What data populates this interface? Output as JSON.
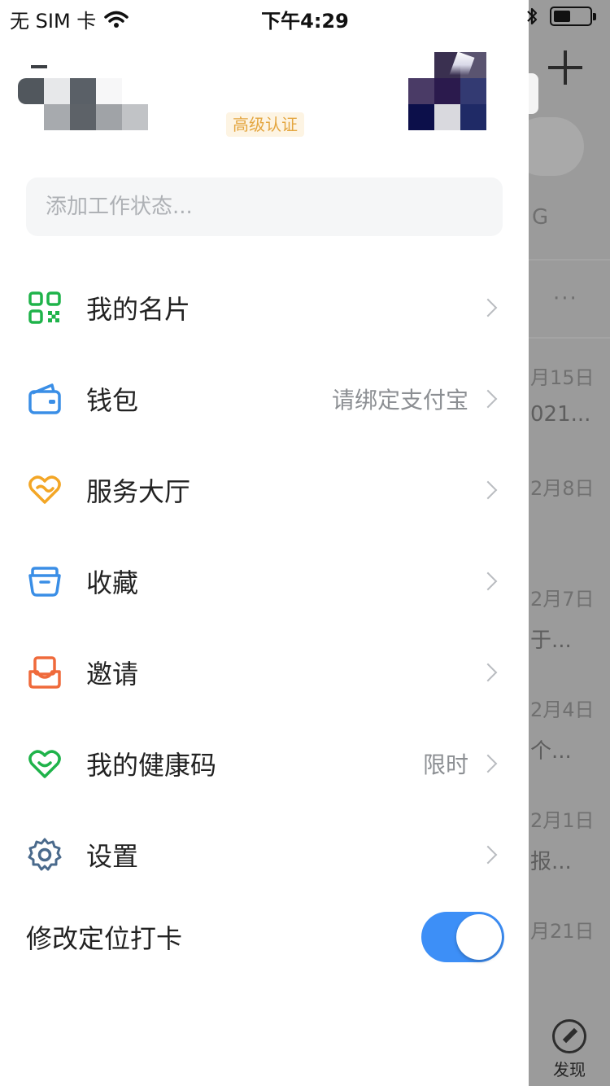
{
  "status_bar": {
    "carrier": "无 SIM 卡",
    "time": "下午4:29",
    "battery_level": 0.45,
    "icons": [
      "wifi-icon",
      "bluetooth-icon",
      "battery-icon"
    ]
  },
  "profile": {
    "badge": "高级认证"
  },
  "work_status": {
    "placeholder": "添加工作状态..."
  },
  "menu": {
    "items": [
      {
        "label": "我的名片",
        "extra": "",
        "icon": "qr-code-icon",
        "color": "#1fb34a"
      },
      {
        "label": "钱包",
        "extra": "请绑定支付宝",
        "icon": "wallet-icon",
        "color": "#3a8ee6"
      },
      {
        "label": "服务大厅",
        "extra": "",
        "icon": "heart-link-icon",
        "color": "#f3a626"
      },
      {
        "label": "收藏",
        "extra": "",
        "icon": "folder-icon",
        "color": "#3a8ee6"
      },
      {
        "label": "邀请",
        "extra": "",
        "icon": "invite-icon",
        "color": "#ef6a3b"
      },
      {
        "label": "我的健康码",
        "extra": "限时",
        "icon": "health-heart-icon",
        "color": "#1fb34a"
      },
      {
        "label": "设置",
        "extra": "",
        "icon": "gear-icon",
        "color": "#4a6a8c"
      }
    ]
  },
  "location_checkin": {
    "label": "修改定位打卡",
    "enabled": true,
    "accent": "#3d8ff7"
  },
  "background_app": {
    "letter": "G",
    "rows": [
      {
        "date": "月15日",
        "text": "021..."
      },
      {
        "date": "2月8日",
        "text": ""
      },
      {
        "date": "2月7日",
        "text": "于..."
      },
      {
        "date": "2月4日",
        "text": "个..."
      },
      {
        "date": "2月1日",
        "text": "报..."
      },
      {
        "date": "月21日",
        "text": ""
      }
    ],
    "tab_label": "发现"
  }
}
